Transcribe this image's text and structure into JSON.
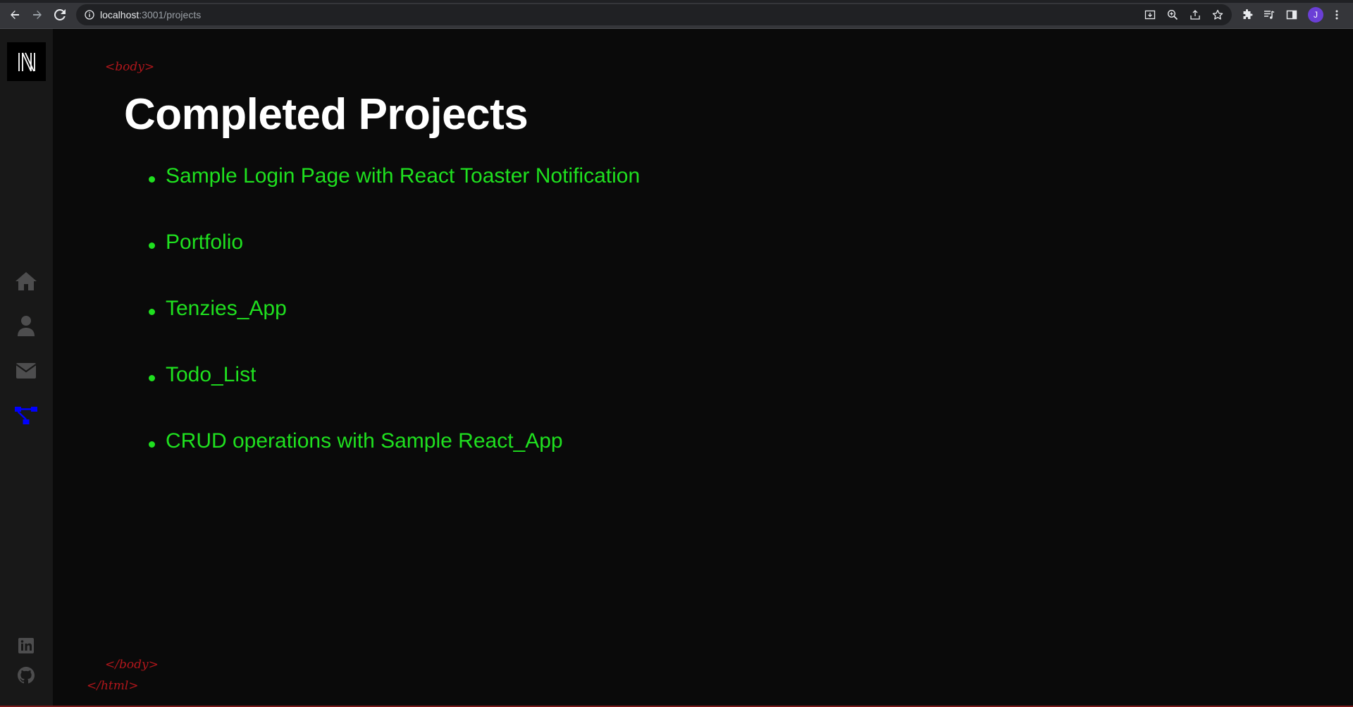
{
  "browser": {
    "url_host": "localhost",
    "url_path": ":3001/projects",
    "profile_initial": "J"
  },
  "sidebar": {
    "logo_letter": "N",
    "nav": [
      {
        "name": "home",
        "icon": "home-icon",
        "active": false
      },
      {
        "name": "about",
        "icon": "user-icon",
        "active": false
      },
      {
        "name": "contact",
        "icon": "envelope-icon",
        "active": false
      },
      {
        "name": "projects",
        "icon": "project-diagram-icon",
        "active": true
      }
    ],
    "social": [
      {
        "name": "linkedin",
        "icon": "linkedin-icon"
      },
      {
        "name": "github",
        "icon": "github-icon"
      }
    ]
  },
  "tags": {
    "body_open": "<body>",
    "body_close": "</body>",
    "html_close": "</html>"
  },
  "page": {
    "title": "Completed Projects",
    "projects": [
      "Sample Login Page with React Toaster Notification",
      "Portfolio",
      "Tenzies_App",
      "Todo_List",
      "CRUD operations with Sample React_App"
    ]
  },
  "colors": {
    "background": "#0a0a0a",
    "sidebar": "#181818",
    "title": "#ffffff",
    "project_link": "#1fe01f",
    "active_nav": "#0000ff",
    "tag": "#b0161b",
    "inactive_icon": "#4d4d4e"
  }
}
